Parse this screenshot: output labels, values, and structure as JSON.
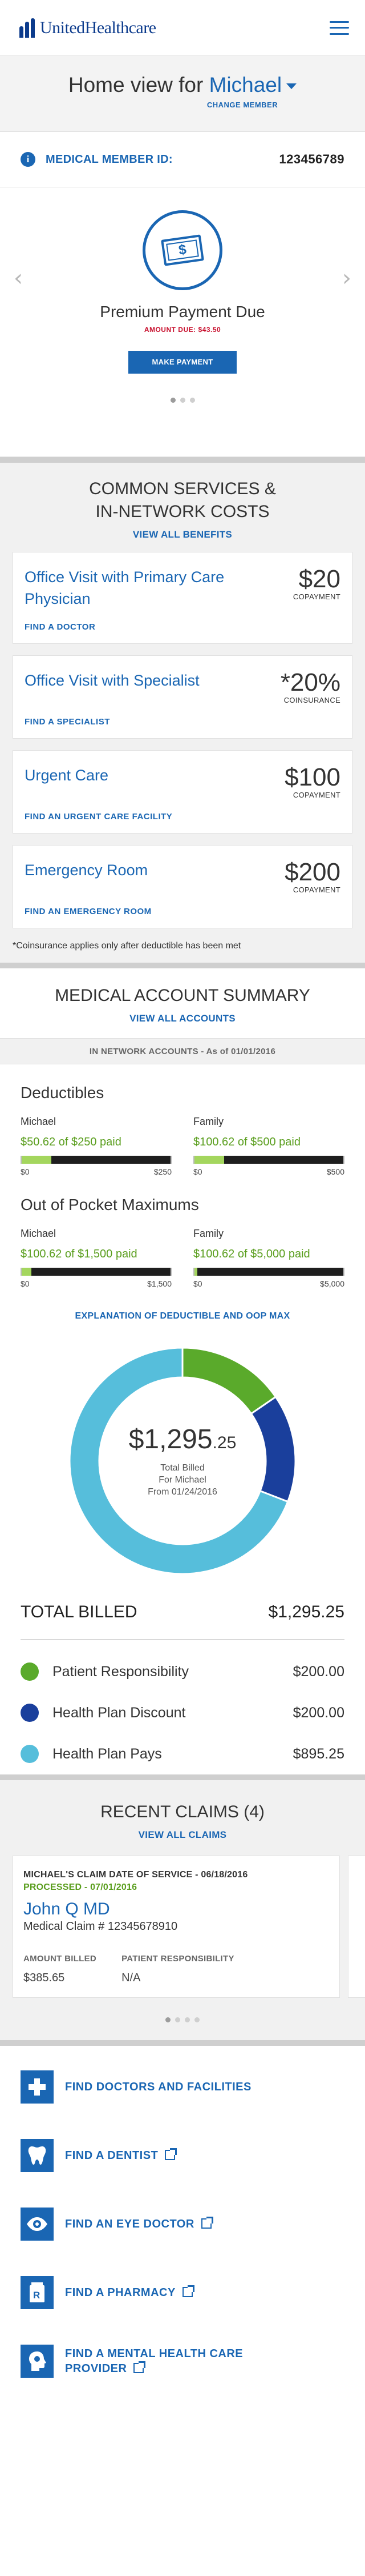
{
  "header": {
    "brand": "UnitedHealthcare",
    "logo_icon": "uhc-bars-logo",
    "menu_icon": "hamburger-menu-icon"
  },
  "homeview": {
    "prefix": "Home view for",
    "member_name": "Michael",
    "change_label": "CHANGE MEMBER"
  },
  "member": {
    "id_label": "MEDICAL MEMBER ID:",
    "id_value": "123456789"
  },
  "payment": {
    "title": "Premium Payment Due",
    "amount_due": "AMOUNT DUE:  $43.50",
    "button": "MAKE PAYMENT",
    "icon": "$"
  },
  "services": {
    "title_line1": "COMMON SERVICES &",
    "title_line2": "IN-NETWORK COSTS",
    "link": "VIEW ALL BENEFITS",
    "items": [
      {
        "name": "Office Visit with Primary Care Physician",
        "amount": "$20",
        "unit": "COPAYMENT",
        "find": "FIND A DOCTOR"
      },
      {
        "name": "Office Visit with Specialist",
        "amount": "*20%",
        "unit": "COINSURANCE",
        "find": "FIND A SPECIALIST"
      },
      {
        "name": "Urgent Care",
        "amount": "$100",
        "unit": "COPAYMENT",
        "find": "FIND AN URGENT CARE FACILITY"
      },
      {
        "name": "Emergency Room",
        "amount": "$200",
        "unit": "COPAYMENT",
        "find": "FIND AN EMERGENCY ROOM"
      }
    ],
    "note": "*Coinsurance applies only after deductible has been met"
  },
  "summary": {
    "title": "MEDICAL ACCOUNT SUMMARY",
    "link": "VIEW ALL ACCOUNTS",
    "in_network": "IN NETWORK ACCOUNTS - As of 01/01/2016",
    "deductibles": {
      "title": "Deductibles",
      "michael": {
        "who": "Michael",
        "paid": "$50.62 of $250 paid",
        "min": "$0",
        "max": "$250",
        "fraction": 0.2
      },
      "family": {
        "who": "Family",
        "paid": "$100.62 of $500 paid",
        "min": "$0",
        "max": "$500",
        "fraction": 0.2
      }
    },
    "oop": {
      "title": "Out of Pocket Maximums",
      "michael": {
        "who": "Michael",
        "paid": "$100.62 of $1,500 paid",
        "min": "$0",
        "max": "$1,500",
        "fraction": 0.067
      },
      "family": {
        "who": "Family",
        "paid": "$100.62 of $5,000 paid",
        "min": "$0",
        "max": "$5,000",
        "fraction": 0.02
      }
    },
    "explain_link": "EXPLANATION OF DEDUCTIBLE AND OOP MAX"
  },
  "billed": {
    "center_amount": "$1,295",
    "center_cents": ".25",
    "center_line1": "Total Billed",
    "center_line2": "For Michael",
    "center_line3": "From 01/24/2016",
    "total_label": "TOTAL BILLED",
    "total_value": "$1,295.25",
    "legend": [
      {
        "label": "Patient Responsibility",
        "value": "$200.00",
        "color": "#5aaa2b"
      },
      {
        "label": "Health Plan Discount",
        "value": "$200.00",
        "color": "#1a3f9c"
      },
      {
        "label": "Health Plan Pays",
        "value": "$895.25",
        "color": "#56bedb"
      }
    ]
  },
  "chart_data": {
    "type": "pie",
    "labels": [
      "Patient Responsibility",
      "Health Plan Discount",
      "Health Plan Pays"
    ],
    "values": [
      200.0,
      200.0,
      895.25
    ],
    "colors": [
      "#5aaa2b",
      "#1a3f9c",
      "#56bedb"
    ],
    "title": "TOTAL BILLED"
  },
  "claims": {
    "title": "RECENT CLAIMS (4)",
    "link": "VIEW ALL CLAIMS",
    "card": {
      "date": "MICHAEL'S CLAIM DATE OF SERVICE - 06/18/2016",
      "status": "PROCESSED - 07/01/2016",
      "doctor": "John Q MD",
      "claim_no": "Medical Claim # 12345678910",
      "billed_label": "AMOUNT BILLED",
      "billed_value": "$385.65",
      "resp_label": "PATIENT RESPONSIBILITY",
      "resp_value": "N/A"
    }
  },
  "find_links": [
    {
      "label": "FIND DOCTORS AND FACILITIES",
      "icon": "plus-icon",
      "external": false
    },
    {
      "label": "FIND A DENTIST",
      "icon": "tooth-icon",
      "external": true
    },
    {
      "label": "FIND AN EYE DOCTOR",
      "icon": "eye-icon",
      "external": true
    },
    {
      "label": "FIND A PHARMACY",
      "icon": "pharmacy-rx-icon",
      "external": true
    },
    {
      "label_line1": "FIND A MENTAL HEALTH CARE",
      "label_line2": "PROVIDER",
      "icon": "mental-health-head-icon",
      "external": true
    }
  ]
}
